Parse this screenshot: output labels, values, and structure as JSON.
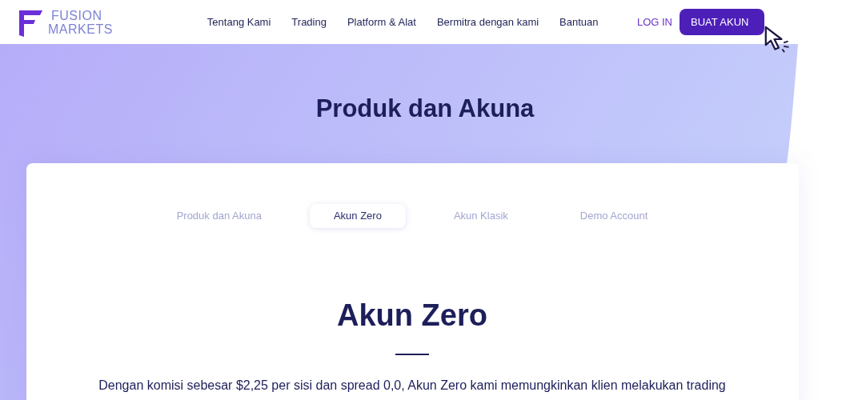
{
  "logo": {
    "line_1": "FUSION",
    "line_2": "MARKETS"
  },
  "nav": [
    "Tentang Kami",
    "Trading",
    "Platform & Alat",
    "Bermitra dengan kami",
    "Bantuan"
  ],
  "login": "LOG IN",
  "signup": "BUAT AKUN",
  "hero_title": "Produk dan Akuna",
  "tabs": [
    {
      "label": "Produk dan Akuna",
      "selected": false
    },
    {
      "label": "Akun Zero",
      "selected": true
    },
    {
      "label": "Akun Klasik",
      "selected": false
    },
    {
      "label": "Demo Account",
      "selected": false
    }
  ],
  "section_title": "Akun Zero",
  "description": "Dengan komisi sebesar $2,25 per sisi dan spread 0,0, Akun Zero kami memungkinkan klien melakukan trading"
}
